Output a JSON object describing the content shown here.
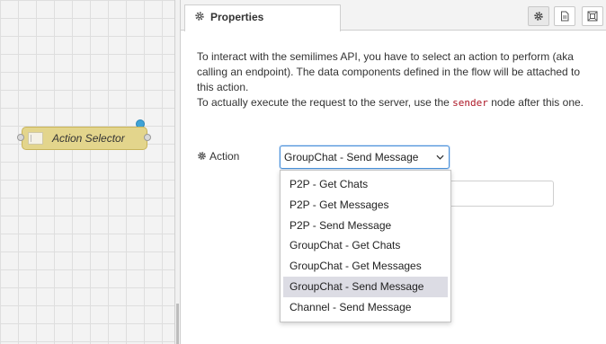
{
  "canvas": {
    "node": {
      "label": "Action Selector"
    }
  },
  "panel": {
    "tab": {
      "title": "Properties"
    },
    "toolbar": {
      "buttons": [
        {
          "icon": "gear-icon"
        },
        {
          "icon": "document-icon"
        },
        {
          "icon": "frame-icon"
        }
      ]
    },
    "description": {
      "line1": "To interact with the semilimes API, you have to select an action to perform (aka calling an endpoint). The data components defined in the flow will be attached to this action.",
      "line2_before": "To actually execute the request to the server, use the ",
      "line2_code": "sender",
      "line2_after": " node after this one."
    },
    "action": {
      "label": "Action",
      "selected": "GroupChat - Send Message",
      "options": [
        "P2P - Get Chats",
        "P2P - Get Messages",
        "P2P - Send Message",
        "GroupChat - Get Chats",
        "GroupChat - Get Messages",
        "GroupChat - Send Message",
        "Channel - Send Message"
      ]
    }
  }
}
